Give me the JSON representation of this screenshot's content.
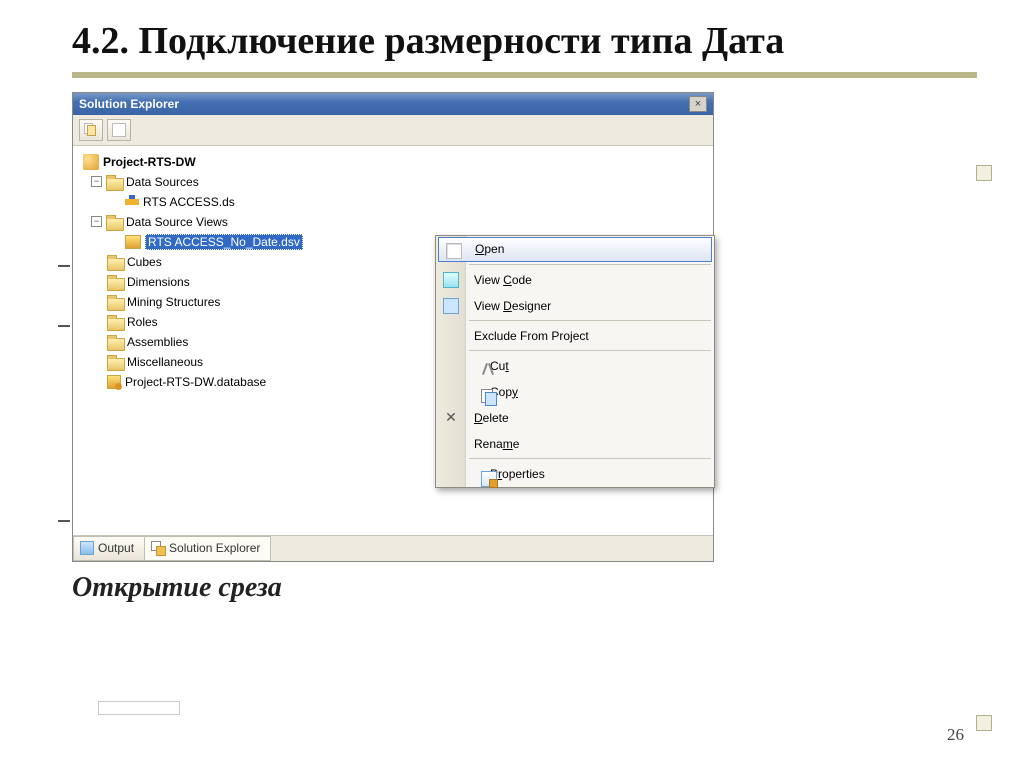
{
  "slide": {
    "heading": "4.2. Подключение размерности типа Дата",
    "caption": "Открытие среза",
    "page_number": "26"
  },
  "panel": {
    "title": "Solution Explorer"
  },
  "tree": {
    "project": "Project-RTS-DW",
    "nodes": [
      {
        "label": "Data Sources",
        "expanded": true,
        "children": [
          {
            "label": "RTS ACCESS.ds"
          }
        ]
      },
      {
        "label": "Data Source Views",
        "expanded": true,
        "children": [
          {
            "label": "RTS ACCESS_No_Date.dsv",
            "selected": true
          }
        ]
      },
      {
        "label": "Cubes"
      },
      {
        "label": "Dimensions"
      },
      {
        "label": "Mining Structures"
      },
      {
        "label": "Roles"
      },
      {
        "label": "Assemblies"
      },
      {
        "label": "Miscellaneous"
      },
      {
        "label": "Project-RTS-DW.database",
        "fileicon": true
      }
    ]
  },
  "tabs": {
    "output": "Output",
    "solution_explorer": "Solution Explorer"
  },
  "menu": {
    "open": "Open",
    "view_code": "View Code",
    "view_designer": "View Designer",
    "exclude": "Exclude From Project",
    "cut": "Cut",
    "copy": "Copy",
    "delete": "Delete",
    "rename": "Rename",
    "properties": "Properties"
  }
}
